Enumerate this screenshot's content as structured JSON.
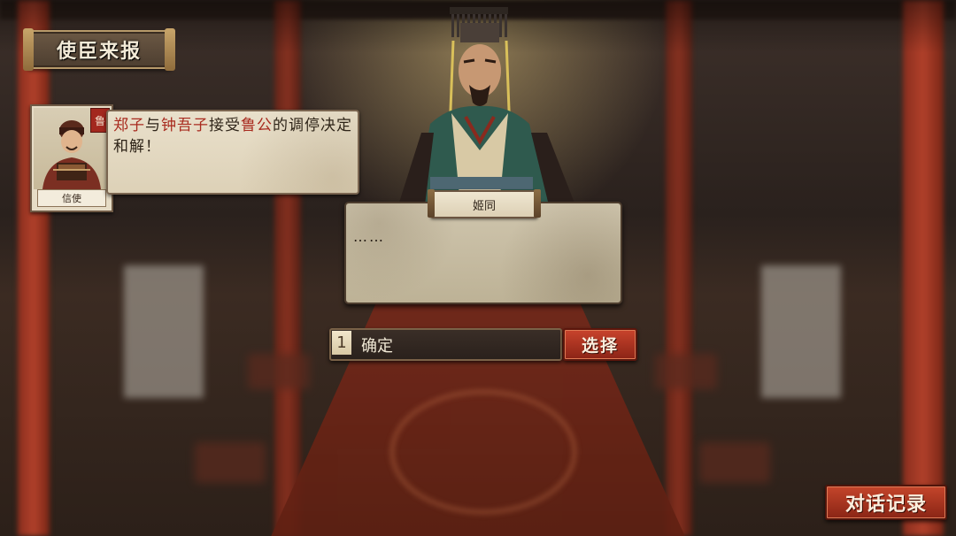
{
  "screen": {
    "title": "使臣来报"
  },
  "report": {
    "seal": "鲁",
    "role": "信使",
    "segments": [
      {
        "text": "郑子",
        "highlight": true
      },
      {
        "text": "与",
        "highlight": false
      },
      {
        "text": "钟吾子",
        "highlight": true
      },
      {
        "text": "接受",
        "highlight": false
      },
      {
        "text": "鲁公",
        "highlight": true
      },
      {
        "text": "的调停决定和解！",
        "highlight": false
      }
    ]
  },
  "dialogue": {
    "speaker": "姬同",
    "text": "……"
  },
  "choices": [
    {
      "number": "1",
      "label": "确定"
    }
  ],
  "buttons": {
    "select": "选择",
    "log": "对话记录"
  },
  "colors": {
    "highlight_text": "#a82a1e",
    "button_red": "#c8432c",
    "parchment": "#e9e0cb",
    "panel_border": "#7a6550"
  }
}
